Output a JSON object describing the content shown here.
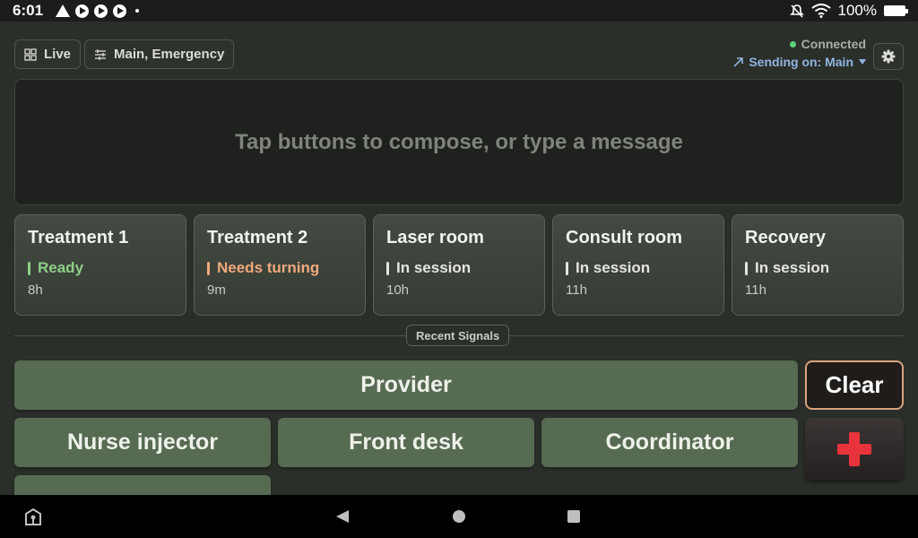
{
  "status_bar": {
    "time": "6:01",
    "battery": "100%",
    "icons": [
      "warning-icon",
      "play-icon",
      "play-icon",
      "play-icon",
      "dot-icon",
      "mute-icon",
      "wifi-icon",
      "battery-icon"
    ]
  },
  "header": {
    "live_chip": "Live",
    "channels_chip": "Main, Emergency",
    "connection_status": "Connected",
    "sending_on": "Sending on: Main"
  },
  "compose": {
    "placeholder": "Tap buttons to compose, or type a message"
  },
  "rooms": [
    {
      "name": "Treatment 1",
      "status": "Ready",
      "age": "8h",
      "status_color": "#8ecf86"
    },
    {
      "name": "Treatment 2",
      "status": "Needs turning",
      "age": "9m",
      "status_color": "#f0a97c"
    },
    {
      "name": "Laser room",
      "status": "In session",
      "age": "10h",
      "status_color": "#e3e6df"
    },
    {
      "name": "Consult room",
      "status": "In session",
      "age": "11h",
      "status_color": "#e3e6df"
    },
    {
      "name": "Recovery",
      "status": "In session",
      "age": "11h",
      "status_color": "#e3e6df"
    }
  ],
  "recent_signals_label": "Recent Signals",
  "signals": {
    "provider": "Provider",
    "nurse_injector": "Nurse injector",
    "front_desk": "Front desk",
    "coordinator": "Coordinator"
  },
  "clear_label": "Clear",
  "colors": {
    "accent_green": "#566b52",
    "emergency_red": "#e8333c",
    "clear_border": "#d9a27c"
  }
}
